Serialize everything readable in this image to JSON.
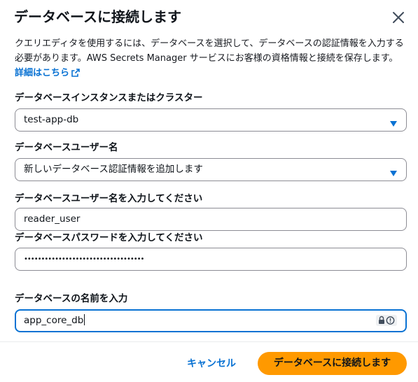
{
  "dialog": {
    "title": "データベースに接続します",
    "description": "クエリエディタを使用するには、データベースを選択して、データベースの認証情報を入力する必要があります。AWS Secrets Manager サービスにお客様の資格情報と接続を保存します。",
    "learn_more_link": "詳細はこちら"
  },
  "fields": {
    "instance": {
      "label": "データベースインスタンスまたはクラスター",
      "value": "test-app-db"
    },
    "username_option": {
      "label": "データベースユーザー名",
      "value": "新しいデータベース認証情報を追加します"
    },
    "username": {
      "label": "データベースユーザー名を入力してください",
      "value": "reader_user"
    },
    "password": {
      "label": "データベースパスワードを入力してください",
      "value": "•••••••••••••••••••••••••••••••••••"
    },
    "database": {
      "label": "データベースの名前を入力",
      "value": "app_core_db"
    }
  },
  "footer": {
    "cancel_label": "キャンセル",
    "connect_label": "データベースに接続します"
  },
  "colors": {
    "accent": "#0972d3",
    "primary_button": "#ff9900"
  },
  "icons": [
    "close-icon",
    "external-link-icon",
    "caret-down-icon",
    "password-manager-icon"
  ]
}
